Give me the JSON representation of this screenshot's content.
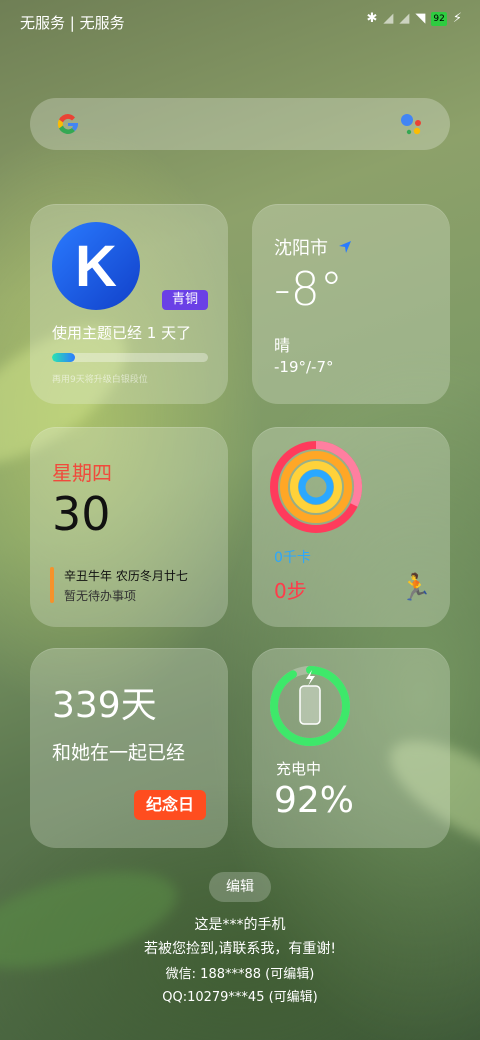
{
  "status": {
    "carrier": "无服务 | 无服务",
    "battery": "92"
  },
  "theme": {
    "level": "青铜",
    "text": "使用主题已经 1 天了",
    "hint": "再用9天将升级白银段位",
    "progress": 0.15
  },
  "weather": {
    "city": "沈阳市",
    "temp": "-8°",
    "condition": "晴",
    "range": "-19°/-7°"
  },
  "calendar": {
    "weekday": "星期四",
    "day": "30",
    "lunar": "辛丑牛年 农历冬月廿七",
    "todo": "暂无待办事项"
  },
  "fitness": {
    "calories": "0千卡",
    "steps": "0步"
  },
  "anniversary": {
    "days": "339天",
    "text": "和她在一起已经",
    "button": "纪念日"
  },
  "battery_widget": {
    "status": "充电中",
    "percent": "92%",
    "level": 0.92
  },
  "edit_label": "编辑",
  "owner_info": {
    "line1": "这是***的手机",
    "line2": "若被您捡到,请联系我，有重谢!",
    "line3": "微信: 188***88 (可编辑)",
    "line4": "QQ:10279***45 (可编辑)"
  },
  "colors": {
    "accent_red": "#ff4d1f",
    "step_red": "#ff3b4a",
    "calorie_blue": "#2aa8ff",
    "level_purple": "#6a40e6"
  }
}
